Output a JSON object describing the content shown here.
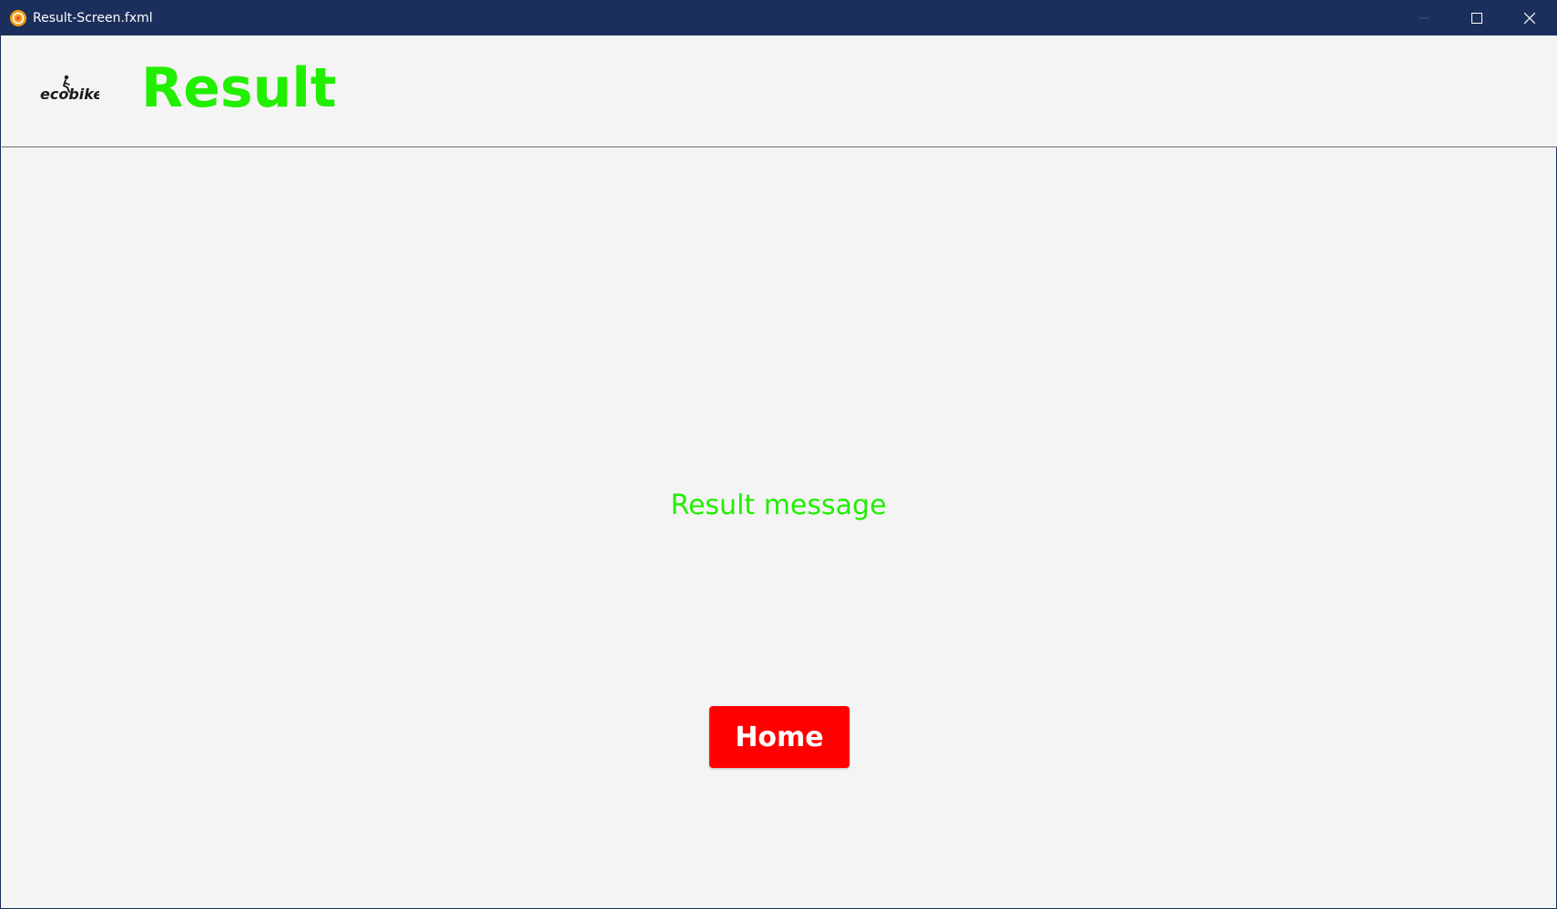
{
  "window": {
    "title": "Result-Screen.fxml",
    "controls": {
      "minimize_icon": "minimize-icon",
      "maximize_icon": "maximize-icon",
      "close_icon": "close-icon"
    }
  },
  "header": {
    "logo_text": "ecobike",
    "title": "Result"
  },
  "main": {
    "message": "Result message",
    "home_button_label": "Home"
  },
  "colors": {
    "titlebar": "#1b2f5c",
    "accent_green": "#22ee00",
    "button_red": "#ff0000",
    "background": "#f4f4f4"
  }
}
